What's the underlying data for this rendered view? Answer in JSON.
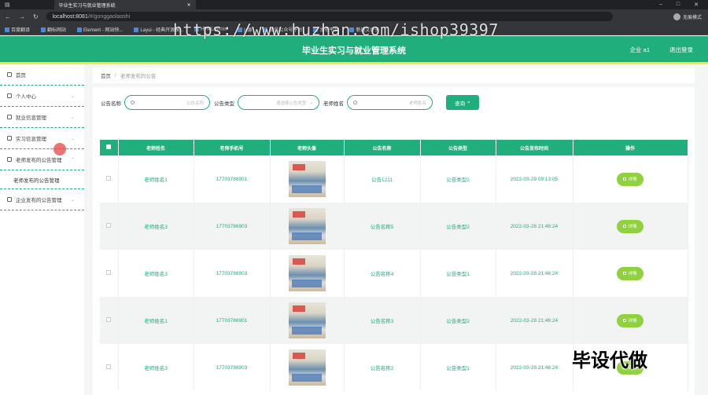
{
  "browser": {
    "tab_title": "毕业生实习与就业管理系统",
    "url_host": "localhost:8081",
    "url_path": "/#/gonggaolaoshi",
    "profile": "无痕模式",
    "bookmarks": [
      "百度翻译",
      "翻标网站",
      "Element - 网站快...",
      "Layui - 经典开源模...",
      "HTML/js/css",
      "js源",
      "微信公众号平台",
      "发布平台",
      "新建文件夹"
    ]
  },
  "header": {
    "title": "毕业生实习与就业管理系统",
    "user": "企业 a1",
    "logout": "退出登录"
  },
  "sidebar": {
    "items": [
      {
        "label": "首页"
      },
      {
        "label": "个人中心"
      },
      {
        "label": "就业信息管理"
      },
      {
        "label": "实习信息管理"
      },
      {
        "label": "老师发布的公告管理"
      },
      {
        "label": "企业发布的公告管理"
      }
    ],
    "sub_item": "老师发布的公告管理"
  },
  "breadcrumb": {
    "home": "首页",
    "sep": "/",
    "current": "老师发布的公告"
  },
  "search": {
    "title_label": "公告名称",
    "title_placeholder": "公告名称",
    "type_label": "公告类型",
    "type_placeholder": "请选择公告类型",
    "teacher_label": "老师姓名",
    "teacher_placeholder": "老师姓名",
    "button": "查询"
  },
  "table": {
    "headers": [
      "老师姓名",
      "老师手机号",
      "老师头像",
      "公告名称",
      "公告类型",
      "公告发布时间",
      "操作"
    ],
    "action_label": "详情",
    "rows": [
      {
        "name": "老师姓名1",
        "phone": "17703786901",
        "title": "公告1211",
        "type": "公告类型2",
        "time": "2022-03-29 09:13:05"
      },
      {
        "name": "老师姓名3",
        "phone": "17703786903",
        "title": "公告名称5",
        "type": "公告类型2",
        "time": "2022-03-28 21:46:24"
      },
      {
        "name": "老师姓名3",
        "phone": "17703786903",
        "title": "公告名称4",
        "type": "公告类型1",
        "time": "2022-03-28 21:46:24"
      },
      {
        "name": "老师姓名1",
        "phone": "17703786901",
        "title": "公告名称3",
        "type": "公告类型2",
        "time": "2022-03-28 21:46:24"
      },
      {
        "name": "老师姓名3",
        "phone": "17703786903",
        "title": "公告名称2",
        "type": "公告类型1",
        "time": "2022-03-28 21:46:24"
      }
    ]
  },
  "watermark": "https://www.huzhan.com/ishop39397",
  "stamp": "毕设代做",
  "colors": {
    "primary": "#1fae7c",
    "accent": "#f2e93a",
    "action": "#8fd13e"
  }
}
